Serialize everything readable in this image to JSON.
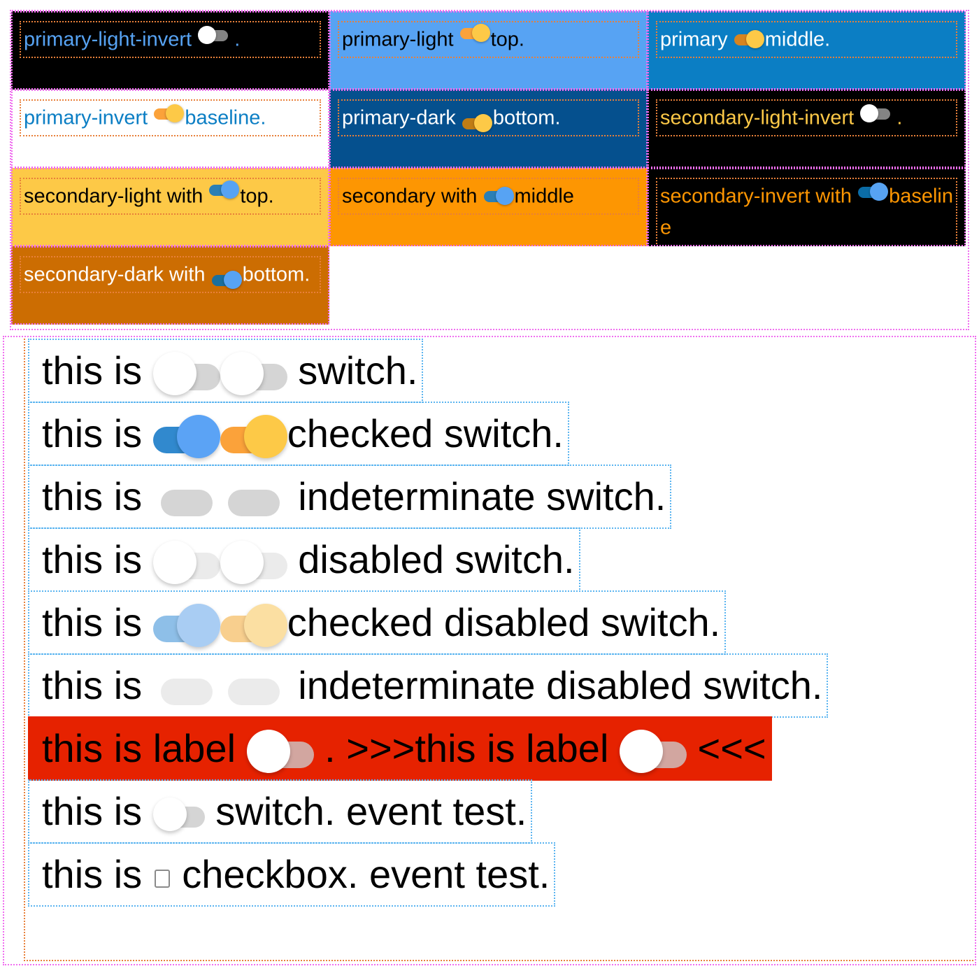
{
  "colors": {
    "primary_light": "#57a3f3",
    "primary": "#0b7ec4",
    "primary_dark": "#05508e",
    "secondary_light": "#fdc947",
    "secondary": "#fd9602",
    "secondary_dark": "#cc6d02",
    "invert_bg": "#000000",
    "invert_primary_text": "#57a3f3",
    "invert_secondary_text": "#fdc947",
    "red_row": "#e62200",
    "grey_track": "#d5d5d5",
    "grey_track_disabled": "#ebebeb",
    "white": "#ffffff",
    "blue_thumb": "#5ba3f5",
    "blue_track": "#3189ce",
    "orange_thumb": "#fdc947",
    "orange_track": "#fba23a",
    "blue_thumb_disabled": "#a9cdf3",
    "blue_track_disabled": "#8ebfe8",
    "orange_thumb_disabled": "#fbdfa2",
    "orange_track_disabled": "#f8cf8e",
    "debug_container_border": "#f06ef0",
    "debug_label_border": "#e8803a",
    "debug_row_border": "#5ab4f0"
  },
  "theme_grid": {
    "cells": [
      {
        "id": "primary-light-invert",
        "prefix": "primary-light-invert ",
        "suffix": " .",
        "bg": "#000000",
        "text": "#57a3f3",
        "switch": {
          "state": "off",
          "thumb": "#ffffff",
          "track": "#848484",
          "align": "baseline"
        }
      },
      {
        "id": "primary-light",
        "prefix": "primary-light ",
        "suffix": "top.",
        "bg": "#57a3f3",
        "text": "#000000",
        "switch": {
          "state": "on",
          "thumb": "#fdc947",
          "track": "#fba23a",
          "align": "top"
        }
      },
      {
        "id": "primary",
        "prefix": "primary ",
        "suffix": "middle.",
        "bg": "#0b7ec4",
        "text": "#ffffff",
        "switch": {
          "state": "on",
          "thumb": "#fdc947",
          "track": "#d68420",
          "align": "middle"
        }
      },
      {
        "id": "primary-invert",
        "prefix": "primary-invert ",
        "suffix": "baseline.",
        "bg": "#ffffff",
        "text": "#0b7ec4",
        "switch": {
          "state": "on",
          "thumb": "#fdc947",
          "track": "#fba23a",
          "align": "baseline"
        }
      },
      {
        "id": "primary-dark",
        "prefix": "primary-dark ",
        "suffix": "bottom.",
        "bg": "#05508e",
        "text": "#ffffff",
        "switch": {
          "state": "on",
          "thumb": "#fdc947",
          "track": "#c07d15",
          "align": "bottom"
        }
      },
      {
        "id": "secondary-light-invert",
        "prefix": "secondary-light-invert ",
        "suffix": " .",
        "bg": "#000000",
        "text": "#fdc947",
        "switch": {
          "state": "off",
          "thumb": "#ffffff",
          "track": "#848484",
          "align": "baseline"
        }
      },
      {
        "id": "secondary-light",
        "prefix": "secondary-light with ",
        "suffix": "top.",
        "bg": "#fdc947",
        "text": "#000000",
        "switch": {
          "state": "on",
          "thumb": "#57a3f3",
          "track": "#2b7fb5",
          "align": "top"
        }
      },
      {
        "id": "secondary",
        "prefix": "secondary with ",
        "suffix": "middle",
        "bg": "#fd9602",
        "text": "#000000",
        "switch": {
          "state": "on",
          "thumb": "#57a3f3",
          "track": "#2b7fb5",
          "align": "middle"
        }
      },
      {
        "id": "secondary-invert",
        "prefix": "secondary-invert with ",
        "suffix": "baseline",
        "bg": "#000000",
        "text": "#fd9602",
        "switch": {
          "state": "on",
          "thumb": "#57a3f3",
          "track": "#0b6ca6",
          "align": "baseline"
        }
      },
      {
        "id": "secondary-dark",
        "prefix": "secondary-dark with ",
        "suffix": "bottom.",
        "bg": "#cc6d02",
        "text": "#ffffff",
        "switch": {
          "state": "on",
          "thumb": "#57a3f3",
          "track": "#1b6f9e",
          "align": "bottom"
        }
      }
    ]
  },
  "demo_rows": [
    {
      "id": "plain-switch",
      "prefix": "this is ",
      "middle": " ",
      "suffix": " switch.",
      "switch_a": {
        "state": "off",
        "thumb": "#ffffff",
        "track": "#d5d5d5"
      },
      "switch_b": {
        "state": "off",
        "thumb": "#ffffff",
        "track": "#d5d5d5"
      }
    },
    {
      "id": "checked-switch",
      "prefix": "this is ",
      "middle": "",
      "suffix": "checked switch.",
      "switch_a": {
        "state": "on",
        "thumb": "#5ba3f5",
        "track": "#3189ce"
      },
      "switch_b": {
        "state": "on",
        "thumb": "#fdc947",
        "track": "#fba23a"
      }
    },
    {
      "id": "indeterminate-switch",
      "prefix": "this is ",
      "middle": " ",
      "suffix": " indeterminate switch.",
      "switch_a": {
        "state": "ind",
        "thumb": "",
        "track": "#d5d5d5"
      },
      "switch_b": {
        "state": "ind",
        "thumb": "",
        "track": "#d5d5d5"
      }
    },
    {
      "id": "disabled-switch",
      "prefix": "this is ",
      "middle": "",
      "suffix": " disabled switch.",
      "switch_a": {
        "state": "off",
        "thumb": "#ffffff",
        "track": "#ebebeb"
      },
      "switch_b": {
        "state": "off",
        "thumb": "#ffffff",
        "track": "#ebebeb"
      }
    },
    {
      "id": "checked-disabled-switch",
      "prefix": "this is ",
      "middle": "",
      "suffix": "checked disabled switch.",
      "switch_a": {
        "state": "on",
        "thumb": "#a9cdf3",
        "track": "#8ebfe8"
      },
      "switch_b": {
        "state": "on",
        "thumb": "#fbdfa2",
        "track": "#f8cf8e"
      }
    },
    {
      "id": "indeterminate-disabled-switch",
      "prefix": "this is ",
      "middle": " ",
      "suffix": " indeterminate disabled switch.",
      "switch_a": {
        "state": "ind",
        "thumb": "",
        "track": "#ebebeb"
      },
      "switch_b": {
        "state": "ind",
        "thumb": "",
        "track": "#ebebeb"
      }
    }
  ],
  "label_row": {
    "id": "label-row",
    "bg": "#e62200",
    "text_1": "this is label ",
    "text_2": " .  >>>this is label ",
    "text_3": " <<<",
    "switch_a": {
      "state": "off",
      "thumb": "#ffffff",
      "track": "#d2a6a0"
    },
    "switch_b": {
      "state": "off",
      "thumb": "#ffffff",
      "track": "#d2a6a0"
    }
  },
  "event_rows": [
    {
      "id": "switch-event-test",
      "prefix": "this is ",
      "suffix": " switch. event test.",
      "switch": {
        "state": "off",
        "thumb": "#ffffff",
        "track": "#d5d5d5"
      }
    },
    {
      "id": "checkbox-event-test",
      "prefix": "this is ",
      "suffix": " checkbox. event test."
    }
  ]
}
